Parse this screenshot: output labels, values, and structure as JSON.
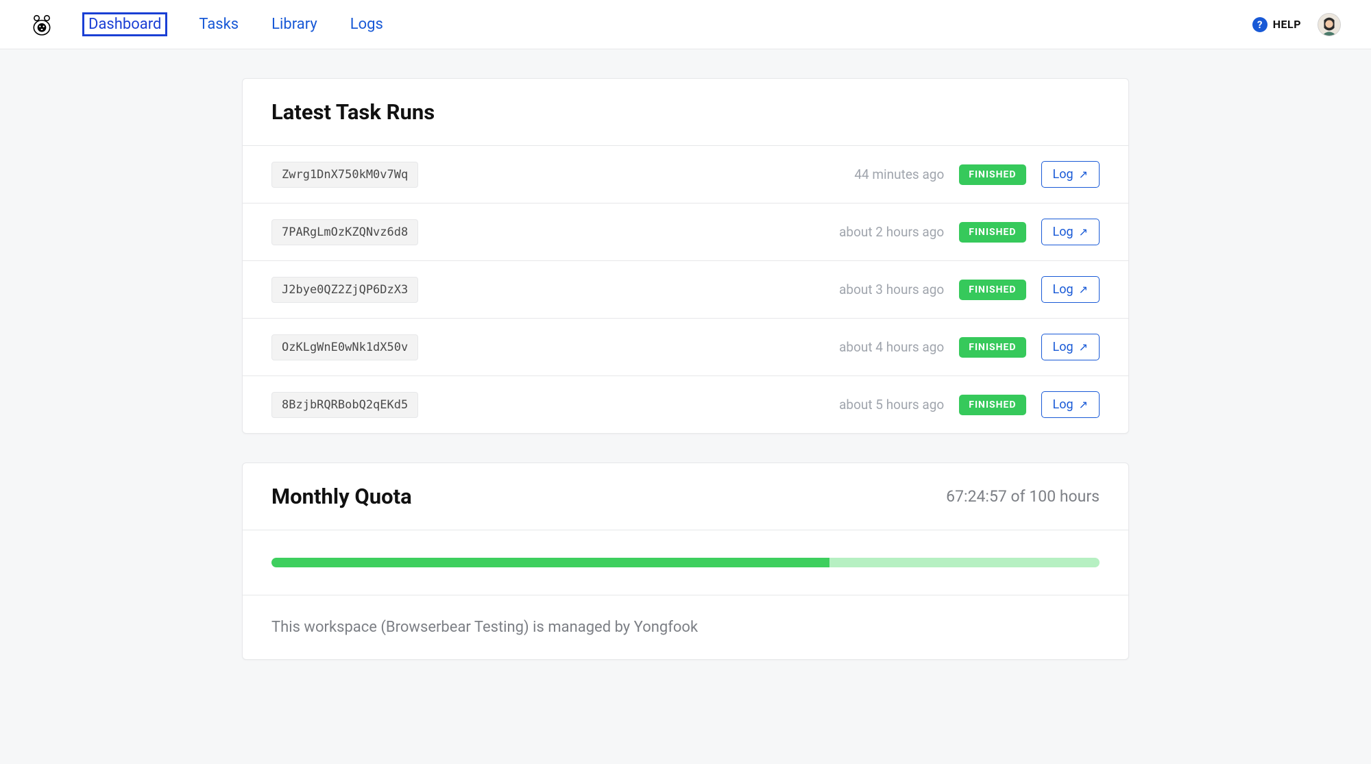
{
  "nav": {
    "items": [
      {
        "label": "Dashboard",
        "active": true
      },
      {
        "label": "Tasks",
        "active": false
      },
      {
        "label": "Library",
        "active": false
      },
      {
        "label": "Logs",
        "active": false
      }
    ],
    "help_label": "HELP"
  },
  "task_runs": {
    "title": "Latest Task Runs",
    "log_button_label": "Log",
    "rows": [
      {
        "id": "Zwrg1DnX750kM0v7Wq",
        "time": "44 minutes ago",
        "status": "FINISHED"
      },
      {
        "id": "7PARgLmOzKZQNvz6d8",
        "time": "about 2 hours ago",
        "status": "FINISHED"
      },
      {
        "id": "J2bye0QZ2ZjQP6DzX3",
        "time": "about 3 hours ago",
        "status": "FINISHED"
      },
      {
        "id": "OzKLgWnE0wNk1dX50v",
        "time": "about 4 hours ago",
        "status": "FINISHED"
      },
      {
        "id": "8BzjbRQRBobQ2qEKd5",
        "time": "about 5 hours ago",
        "status": "FINISHED"
      }
    ]
  },
  "quota": {
    "title": "Monthly Quota",
    "usage_text": "67:24:57 of 100 hours",
    "percent": 67.4,
    "footer": "This workspace (Browserbear Testing) is managed by Yongfook"
  }
}
